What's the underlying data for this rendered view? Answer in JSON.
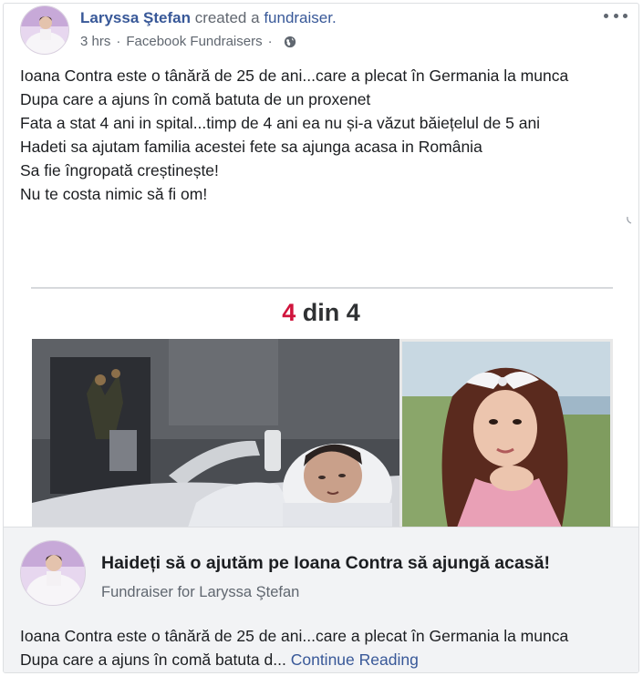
{
  "header": {
    "author": "Laryssa Ştefan",
    "verb": "created a",
    "object": "fundraiser.",
    "time": "3 hrs",
    "separator": "·",
    "source": "Facebook Fundraisers",
    "audience_icon": "globe-icon",
    "more_icon": "more-options-icon"
  },
  "post": {
    "lines": [
      "Ioana Contra este o tânără de 25 de ani...care a plecat în Germania la munca",
      "Dupa care a ajuns în comă batuta de un proxenet",
      "Fata a stat 4 ani in spital...timp de 4 ani ea nu și-a văzut băiețelul de 5 ani",
      "Hadeti sa ajutam familia acestei fete sa ajunga acasa in România",
      "Sa fie îngropată creștinește!",
      "Nu te costa nimic să fi om!"
    ]
  },
  "image": {
    "headline_accent": "4",
    "headline_rest": " din 4"
  },
  "fundraiser": {
    "title": "Haideți să o ajutăm pe Ioana Contra să ajungă acasă!",
    "subtitle": "Fundraiser for Laryssa Ştefan",
    "desc_line1": "Ioana Contra este o tânără de 25 de ani...care a plecat în Germania la munca",
    "desc_line2": "Dupa care a ajuns în comă batuta d...",
    "continue_label": "Continue Reading"
  },
  "colors": {
    "link": "#385898",
    "accent": "#d0143c",
    "meta": "#606770"
  }
}
